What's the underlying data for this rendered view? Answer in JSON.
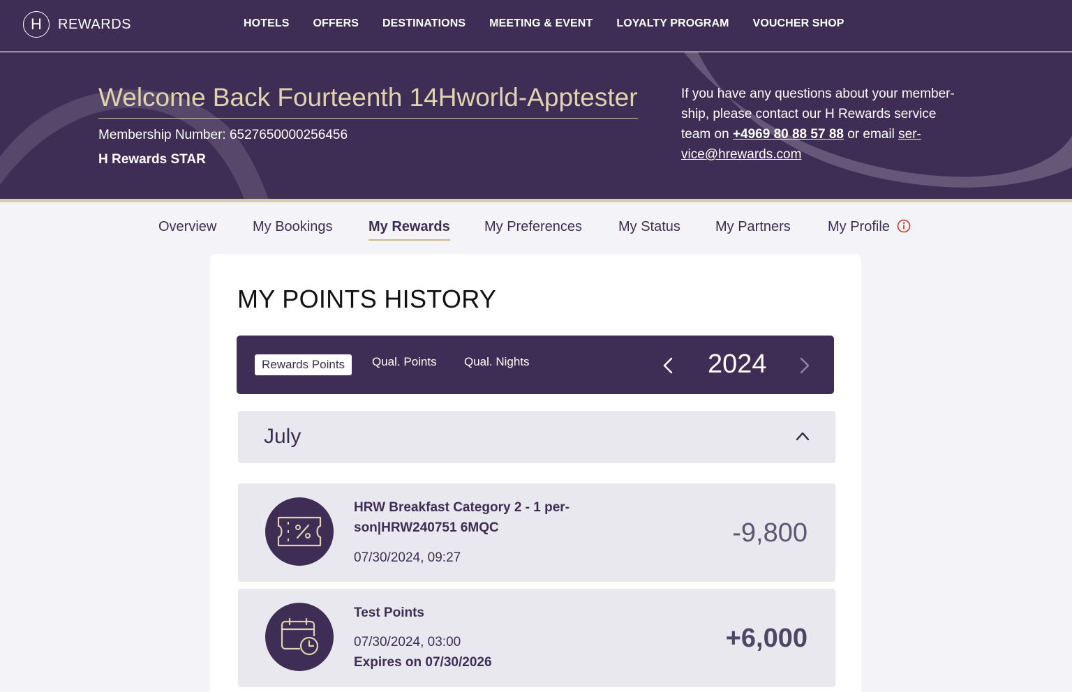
{
  "brand": {
    "logo_letter": "H",
    "name": "REWARDS"
  },
  "topnav": [
    "HOTELS",
    "OFFERS",
    "DESTINATIONS",
    "MEETING & EVENT",
    "LOYALTY PROGRAM",
    "VOUCHER SHOP"
  ],
  "hero": {
    "welcome": "Welcome Back Fourteenth 14Hworld-Apptester",
    "membership_number": "Membership Number: 6527650000256456",
    "tier": "H Rewards STAR",
    "contact_line1": "If you have any questions about your member-",
    "contact_line2": "ship, please contact our H Rewards service",
    "contact_line3_prefix": "team on ",
    "contact_phone": "+4969 80 88 57 88",
    "contact_line3_mid": " or email ",
    "contact_email_part1": "ser-",
    "contact_email_part2": "vice@hrewards.com"
  },
  "tabs": [
    "Overview",
    "My Bookings",
    "My Rewards",
    "My Preferences",
    "My Status",
    "My Partners",
    "My Profile"
  ],
  "active_tab": "My Rewards",
  "history": {
    "title": "MY POINTS HISTORY",
    "filters": [
      "Rewards Points",
      "Qual. Points",
      "Qual. Nights"
    ],
    "active_filter": "Rewards Points",
    "year": "2024",
    "month": "July",
    "entries": [
      {
        "icon": "voucher-percent-icon",
        "title_line1": "HRW Breakfast Category 2 - 1 per-",
        "title_line2": "son|HRW240751 6MQC",
        "date": "07/30/2024, 09:27",
        "points": "-9,800"
      },
      {
        "icon": "calendar-clock-icon",
        "title_line1": "Test Points",
        "date": "07/30/2024, 03:00",
        "expiry": "Expires on 07/30/2026",
        "points": "+6,000"
      }
    ]
  },
  "colors": {
    "brand_purple": "#3e2d55",
    "gold": "#e2d3b0",
    "panel_gray": "#e9e8ee",
    "alert_red": "#c9372c"
  }
}
